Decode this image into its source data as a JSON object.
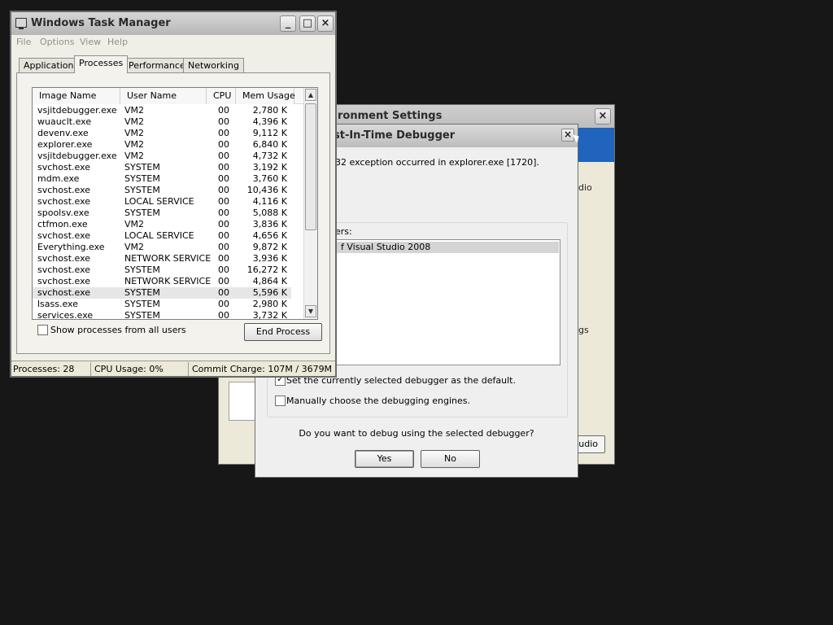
{
  "env_dialog": {
    "title": "ronment Settings",
    "side_text_1": "dio",
    "side_text_2": "gs",
    "button_label": "udio"
  },
  "jit_dialog": {
    "title": "st-In-Time Debugger",
    "close_glyph": "×",
    "message": "32 exception occurred in explorer.exe [1720].",
    "list_label": "ers:",
    "debuggers": [
      "f Visual Studio 2008"
    ],
    "default_checkbox_label": "Set the currently selected debugger as the default.",
    "default_checked": true,
    "manual_checkbox_label": "Manually choose the debugging engines.",
    "manual_checked": false,
    "question": "Do you want to debug using the selected debugger?",
    "yes_label": "Yes",
    "no_label": "No"
  },
  "task_manager": {
    "title": "Windows Task Manager",
    "window_buttons": {
      "minimize": "_",
      "maximize": "□",
      "close": "×"
    },
    "menu": [
      "File",
      "Options",
      "View",
      "Help"
    ],
    "tabs": [
      "Applications",
      "Processes",
      "Performance",
      "Networking"
    ],
    "active_tab": "Processes",
    "columns": [
      "Image Name",
      "User Name",
      "CPU",
      "Mem Usage"
    ],
    "processes": [
      {
        "name": "vsjitdebugger.exe",
        "user": "VM2",
        "cpu": "00",
        "mem": "2,780 K"
      },
      {
        "name": "wuauclt.exe",
        "user": "VM2",
        "cpu": "00",
        "mem": "4,396 K"
      },
      {
        "name": "devenv.exe",
        "user": "VM2",
        "cpu": "00",
        "mem": "9,112 K"
      },
      {
        "name": "explorer.exe",
        "user": "VM2",
        "cpu": "00",
        "mem": "6,840 K"
      },
      {
        "name": "vsjitdebugger.exe",
        "user": "VM2",
        "cpu": "00",
        "mem": "4,732 K"
      },
      {
        "name": "svchost.exe",
        "user": "SYSTEM",
        "cpu": "00",
        "mem": "3,192 K"
      },
      {
        "name": "mdm.exe",
        "user": "SYSTEM",
        "cpu": "00",
        "mem": "3,760 K"
      },
      {
        "name": "svchost.exe",
        "user": "SYSTEM",
        "cpu": "00",
        "mem": "10,436 K"
      },
      {
        "name": "svchost.exe",
        "user": "LOCAL SERVICE",
        "cpu": "00",
        "mem": "4,116 K"
      },
      {
        "name": "spoolsv.exe",
        "user": "SYSTEM",
        "cpu": "00",
        "mem": "5,088 K"
      },
      {
        "name": "ctfmon.exe",
        "user": "VM2",
        "cpu": "00",
        "mem": "3,836 K"
      },
      {
        "name": "svchost.exe",
        "user": "LOCAL SERVICE",
        "cpu": "00",
        "mem": "4,656 K"
      },
      {
        "name": "Everything.exe",
        "user": "VM2",
        "cpu": "00",
        "mem": "9,872 K"
      },
      {
        "name": "svchost.exe",
        "user": "NETWORK SERVICE",
        "cpu": "00",
        "mem": "3,936 K"
      },
      {
        "name": "svchost.exe",
        "user": "SYSTEM",
        "cpu": "00",
        "mem": "16,272 K"
      },
      {
        "name": "svchost.exe",
        "user": "NETWORK SERVICE",
        "cpu": "00",
        "mem": "4,864 K"
      },
      {
        "name": "svchost.exe",
        "user": "SYSTEM",
        "cpu": "00",
        "mem": "5,596 K"
      },
      {
        "name": "lsass.exe",
        "user": "SYSTEM",
        "cpu": "00",
        "mem": "2,980 K"
      },
      {
        "name": "services.exe",
        "user": "SYSTEM",
        "cpu": "00",
        "mem": "3,732 K"
      }
    ],
    "selected_process_index": 16,
    "show_all_label": "Show processes from all users",
    "show_all_checked": false,
    "end_process_label": "End Process",
    "status": {
      "processes": "Processes: 28",
      "cpu": "CPU Usage: 0%",
      "commit": "Commit Charge: 107M / 3679M"
    }
  }
}
